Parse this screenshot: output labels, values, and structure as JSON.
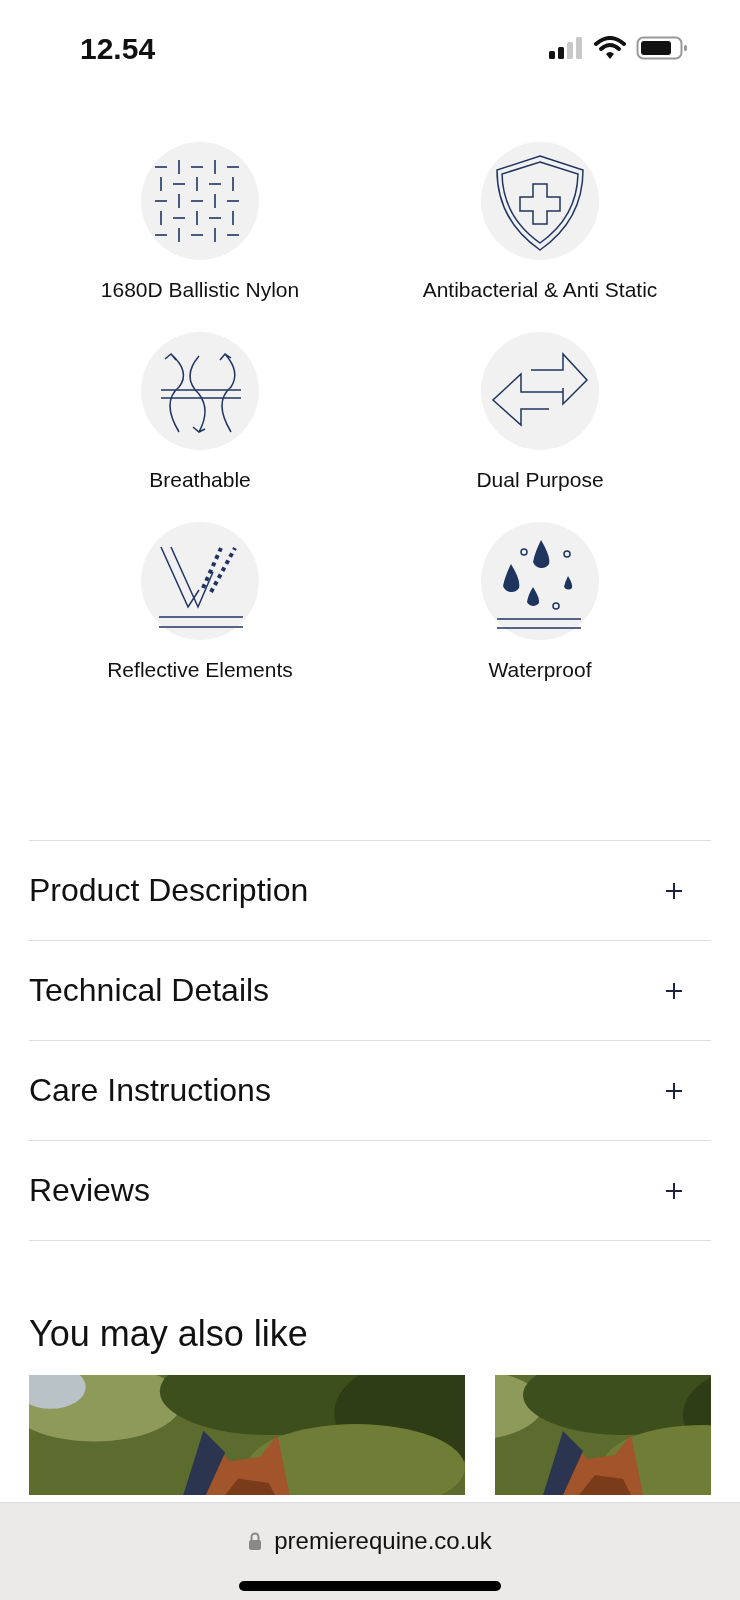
{
  "status_bar": {
    "time": "12.54"
  },
  "features": [
    {
      "kind": "weave",
      "label": "1680D Ballistic Nylon"
    },
    {
      "kind": "shield",
      "label": "Antibacterial & Anti Static"
    },
    {
      "kind": "airflow",
      "label": "Breathable"
    },
    {
      "kind": "arrows",
      "label": "Dual Purpose"
    },
    {
      "kind": "reflective",
      "label": "Reflective Elements"
    },
    {
      "kind": "drops",
      "label": "Waterproof"
    }
  ],
  "accordion": [
    {
      "title": "Product Description",
      "expanded": false
    },
    {
      "title": "Technical Details",
      "expanded": false
    },
    {
      "title": "Care Instructions",
      "expanded": false
    },
    {
      "title": "Reviews",
      "expanded": false
    }
  ],
  "related": {
    "title": "You may also like"
  },
  "browser_bar": {
    "url": "premierequine.co.uk"
  }
}
